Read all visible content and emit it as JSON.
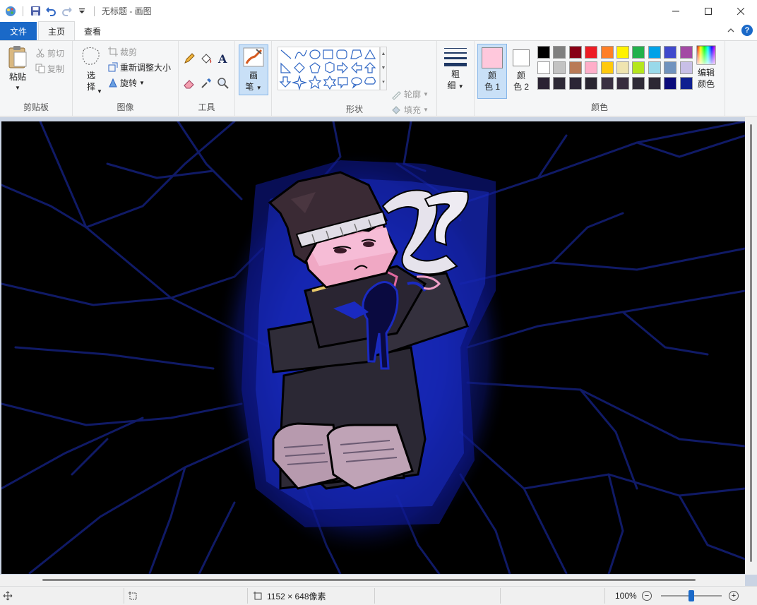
{
  "window": {
    "title": "无标题 - 画图"
  },
  "tabs": {
    "file": "文件",
    "home": "主页",
    "view": "查看"
  },
  "ribbon": {
    "clipboard": {
      "group": "剪贴板",
      "paste": "粘贴",
      "cut": "剪切",
      "copy": "复制"
    },
    "image": {
      "group": "图像",
      "select_top": "选",
      "select_bottom": "择",
      "crop": "裁剪",
      "resize": "重新调整大小",
      "rotate": "旋转"
    },
    "tools": {
      "group": "工具"
    },
    "brushes": {
      "top": "画",
      "bottom": "笔"
    },
    "shapes": {
      "group": "形状",
      "outline": "轮廓",
      "fill": "填充"
    },
    "size": {
      "top": "粗",
      "bottom": "细"
    },
    "colors": {
      "group": "颜色",
      "color1_top": "颜",
      "color1_bottom": "色 1",
      "color2_top": "颜",
      "color2_bottom": "色 2",
      "edit_top": "编辑",
      "edit_bottom": "颜色",
      "color1": "#ffc8dc",
      "color2": "#ffffff",
      "palette_row1": [
        "#000000",
        "#7f7f7f",
        "#880015",
        "#ed1c24",
        "#ff7f27",
        "#fff200",
        "#22b14c",
        "#00a2e8",
        "#3f48cc",
        "#a349a4"
      ],
      "palette_row2": [
        "#ffffff",
        "#c3c3c3",
        "#b97a57",
        "#ffaec9",
        "#ffc90e",
        "#efe4b0",
        "#b5e61d",
        "#99d9ea",
        "#7092be",
        "#c8bfe7"
      ],
      "palette_row3": [
        "#2a2232",
        "#2e2a36",
        "#2b2535",
        "#2a2530",
        "#3a3042",
        "#372c3e",
        "#2f2b37",
        "#2c2733",
        "#0b0b7a",
        "#102090"
      ]
    }
  },
  "status": {
    "dimensions": "1152 × 648像素",
    "zoom": "100%"
  }
}
